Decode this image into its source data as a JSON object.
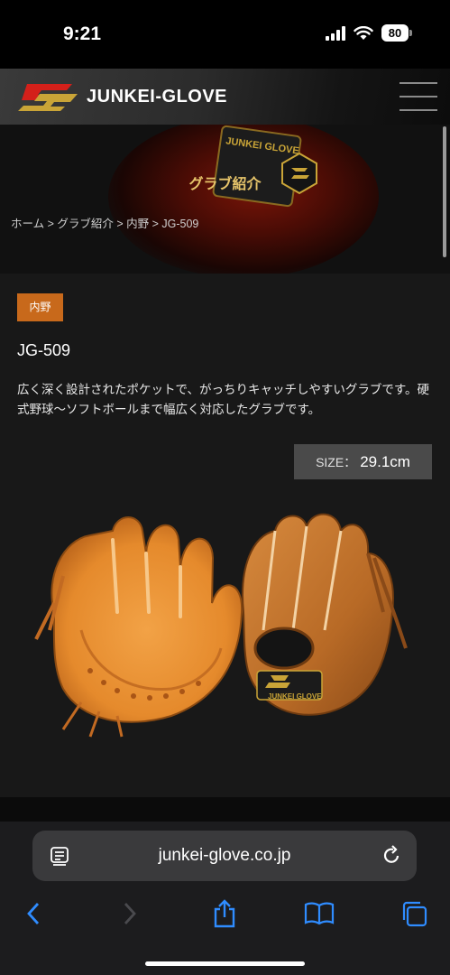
{
  "status_bar": {
    "time": "9:21",
    "battery": "80"
  },
  "header": {
    "logo_text": "JUNKEI-GLOVE"
  },
  "hero": {
    "title": "グラブ紹介",
    "patch_text": "JUNKEI GLOVE",
    "breadcrumb": "ホーム > グラブ紹介 > 内野 > JG-509"
  },
  "product": {
    "category": "内野",
    "name": "JG-509",
    "description": "広く深く設計されたポケットで、がっちりキャッチしやすいグラブです。硬式野球～ソフトボールまで幅広く対応したグラブです。",
    "size_label": "SIZE：",
    "size_value": "29.1cm",
    "glove_stamp": "JUNKEI GLOVE"
  },
  "browser": {
    "url": "junkei-glove.co.jp"
  },
  "colors": {
    "accent_orange": "#c8691b",
    "hero_gold": "#e6c46a",
    "logo_red": "#d4201a",
    "logo_gold": "#c9a437"
  }
}
